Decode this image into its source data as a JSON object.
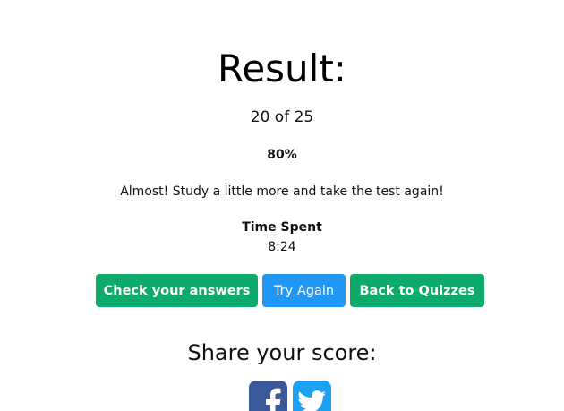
{
  "result": {
    "title": "Result:",
    "score_text": "20 of 25",
    "percent_text": "80%",
    "message": "Almost! Study a little more and take the test again!",
    "time_label": "Time Spent",
    "time_value": "8:24"
  },
  "actions": {
    "check_answers_label": "Check your answers",
    "try_again_label": "Try Again",
    "back_label": "Back to Quizzes"
  },
  "share": {
    "title": "Share your score:",
    "icons": [
      "facebook-icon",
      "twitter-icon"
    ]
  },
  "colors": {
    "green_button": "#0eaa6a",
    "blue_button": "#2196f3",
    "facebook": "#3b5998",
    "twitter": "#1da1f2"
  }
}
